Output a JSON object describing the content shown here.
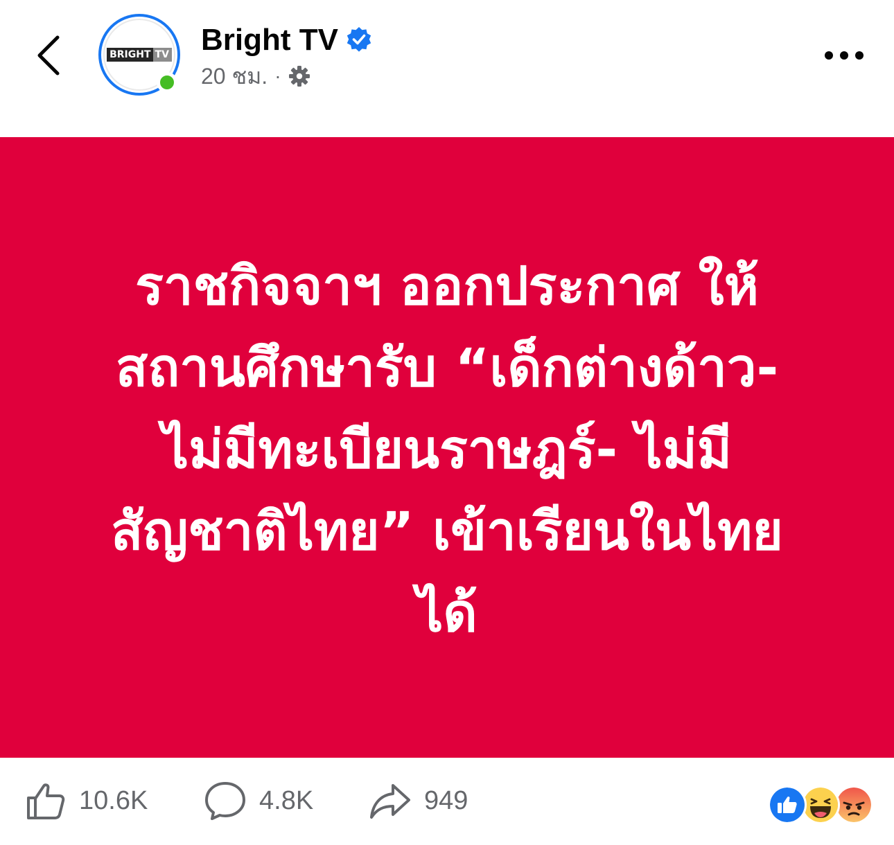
{
  "header": {
    "page_name": "Bright TV",
    "logo_text_1": "BRIGHT",
    "logo_text_2": "TV",
    "time": "20 ชม.",
    "separator": "·",
    "icons": {
      "back": "chevron-left-icon",
      "verified": "verified-badge-icon",
      "privacy": "settings-gear-icon",
      "more": "more-dots-icon"
    }
  },
  "post": {
    "background_color": "#e0003c",
    "lines": [
      "ราชกิจจาฯ ออกประกาศ ให้",
      "สถานศึกษารับ “เด็กต่างด้าว-",
      "ไม่มีทะเบียนราษฎร์- ไม่มี",
      "สัญชาติไทย” เข้าเรียนในไทย",
      "ได้"
    ]
  },
  "actions": {
    "like_count": "10.6K",
    "comment_count": "4.8K",
    "share_count": "949",
    "reactions": [
      "like-reaction-icon",
      "haha-reaction-icon",
      "angry-reaction-icon"
    ]
  },
  "colors": {
    "brand_blue": "#1877f2",
    "online_green": "#45bd24",
    "muted_text": "#65676b"
  }
}
